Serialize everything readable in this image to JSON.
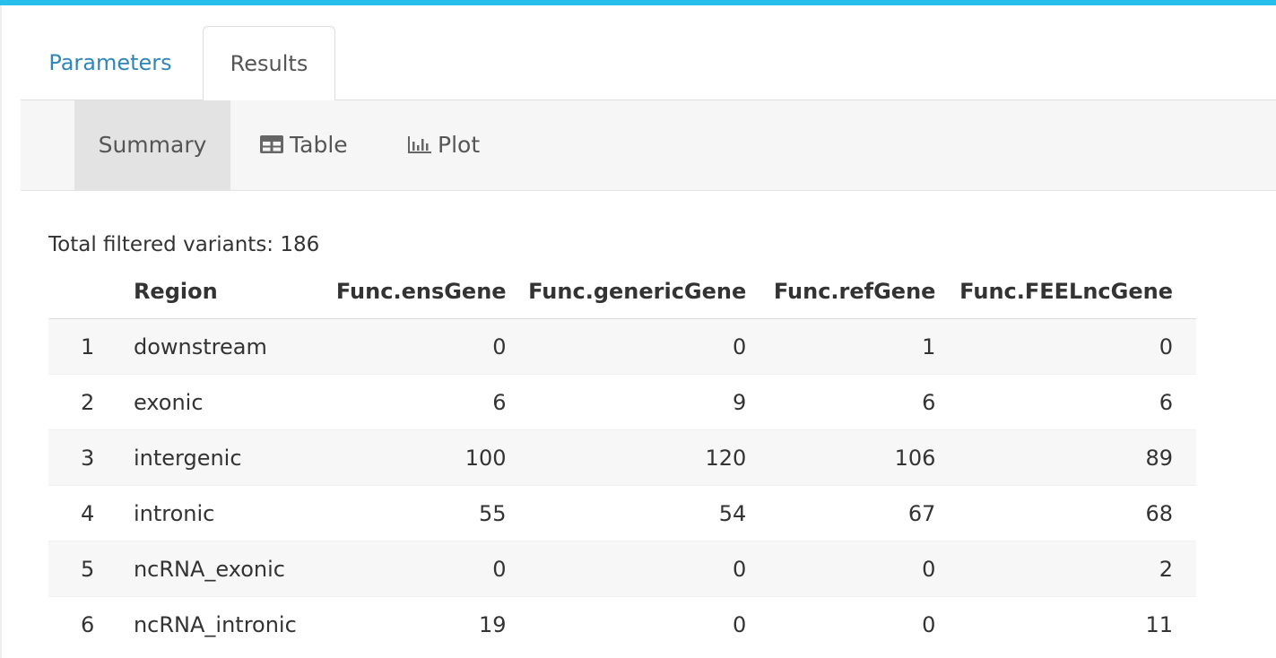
{
  "colors": {
    "accent_bar": "#27c0ec",
    "link": "#2f86b9",
    "active_subtab_bg": "#e3e3e3"
  },
  "tabs": [
    {
      "label": "Parameters",
      "active": false
    },
    {
      "label": "Results",
      "active": true
    }
  ],
  "subtabs": [
    {
      "label": "Summary",
      "icon": "",
      "active": true
    },
    {
      "label": "Table",
      "icon": "table-icon",
      "active": false
    },
    {
      "label": "Plot",
      "icon": "bar-chart-icon",
      "active": false
    }
  ],
  "summary": {
    "total_text": "Total filtered variants: 186"
  },
  "table": {
    "columns": [
      "",
      "Region",
      "Func.ensGene",
      "Func.genericGene",
      "Func.refGene",
      "Func.FEELncGene"
    ],
    "rows": [
      [
        "1",
        "downstream",
        "0",
        "0",
        "1",
        "0"
      ],
      [
        "2",
        "exonic",
        "6",
        "9",
        "6",
        "6"
      ],
      [
        "3",
        "intergenic",
        "100",
        "120",
        "106",
        "89"
      ],
      [
        "4",
        "intronic",
        "55",
        "54",
        "67",
        "68"
      ],
      [
        "5",
        "ncRNA_exonic",
        "0",
        "0",
        "0",
        "2"
      ],
      [
        "6",
        "ncRNA_intronic",
        "19",
        "0",
        "0",
        "11"
      ]
    ]
  }
}
